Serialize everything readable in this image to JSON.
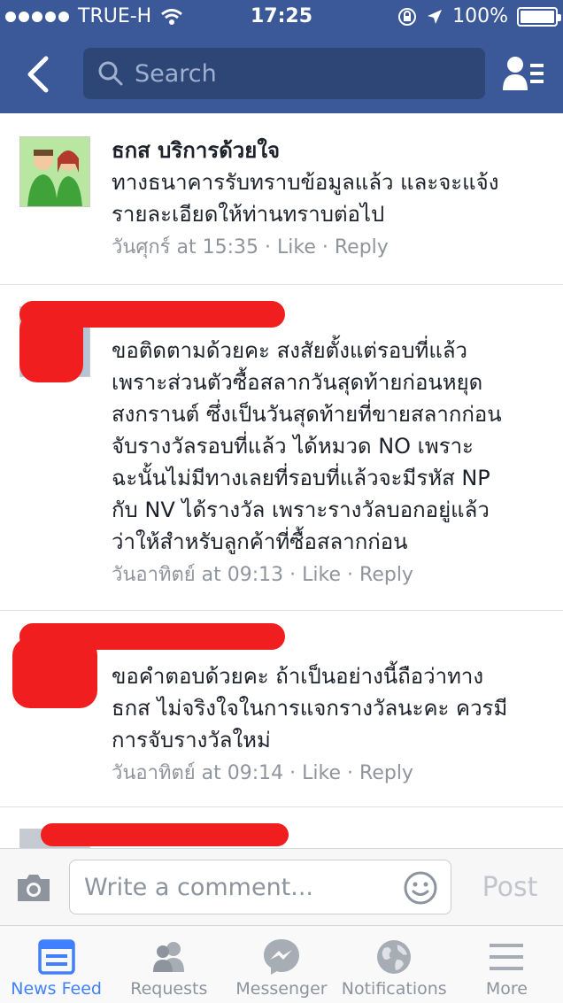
{
  "status_bar": {
    "carrier": "TRUE-H",
    "time": "17:25",
    "battery": "100%"
  },
  "header": {
    "search_placeholder": "Search"
  },
  "comments": [
    {
      "name": "ธกส บริการด้วยใจ",
      "lines": [
        "ทางธนาคารรับทราบข้อมูลแล้ว และจะแจ้ง",
        "รายละเอียดให้ท่านทราบต่อไป"
      ],
      "time": "วันศุกร์ at 15:35",
      "like": "Like",
      "reply": "Reply"
    },
    {
      "name": "",
      "lines": [
        "ขอติดตามด้วยคะ สงสัยตั้งแต่รอบที่แล้ว",
        "เพราะส่วนตัวซื้อสลากวันสุดท้ายก่อนหยุด",
        "สงกรานต์ ซึ่งเป็นวันสุดท้ายที่ขายสลากก่อน",
        "จับรางวัลรอบที่แล้ว ได้หมวด NO เพราะ",
        "ฉะนั้นไม่มีทางเลยที่รอบที่แล้วจะมีรหัส NP",
        "กับ NV ได้รางวัล เพราะรางวัลบอกอยู่แล้ว",
        "ว่าให้สำหรับลูกค้าที่ซื้อสลากก่อน"
      ],
      "time": "วันอาทิตย์ at 09:13",
      "like": "Like",
      "reply": "Reply"
    },
    {
      "name": "",
      "lines": [
        "ขอคำตอบด้วยคะ ถ้าเป็นอย่างนี้ถือว่าทาง",
        "ธกส ไม่จริงใจในการแจกรางวัลนะคะ ควรมี",
        "การจับรางวัลใหม่"
      ],
      "time": "วันอาทิตย์ at 09:14",
      "like": "Like",
      "reply": "Reply"
    }
  ],
  "composer": {
    "placeholder": "Write a comment...",
    "post_label": "Post"
  },
  "tabs": [
    {
      "label": "News Feed",
      "icon": "news-feed-icon",
      "active": true
    },
    {
      "label": "Requests",
      "icon": "friend-requests-icon",
      "active": false
    },
    {
      "label": "Messenger",
      "icon": "messenger-icon",
      "active": false
    },
    {
      "label": "Notifications",
      "icon": "globe-icon",
      "active": false
    },
    {
      "label": "More",
      "icon": "menu-icon",
      "active": false
    }
  ],
  "colors": {
    "header_bg": "#3b5998",
    "active_tab": "#4080ff",
    "meta_text": "#90949c",
    "redaction": "#f01e1e"
  }
}
